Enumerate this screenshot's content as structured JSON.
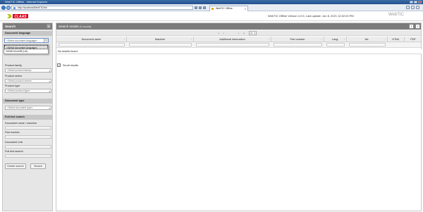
{
  "browser": {
    "title": "WebTIC Offline - Internet Explorer",
    "url": "http://localhost/WebTIC/en/",
    "tab_label": "WebTIC Offline"
  },
  "header": {
    "logo_text": "CLAAS",
    "version_text": "WebTIC Offline Version 4.0.5, Last update: Jun 8, 2021 12:02:03 PM",
    "app_title": "WebTIC"
  },
  "sidebar": {
    "title": "Search",
    "collapse_icon": "«",
    "document_language": {
      "heading": "Document language",
      "selected": "<Select document language>",
      "options": [
        "<Select document language>",
        "УКРАЇНСЬКИЙ (UK)"
      ]
    },
    "product_family_label": "Product family",
    "product_family_value": "<Select product family>",
    "product_series_label": "Product series",
    "product_series_value": "<Select product series>",
    "product_type_label": "Product type",
    "product_type_value": "<Select product type>",
    "document_type": {
      "heading": "Document type",
      "value": "<Select document type>"
    },
    "full_text": {
      "heading": "Full text search",
      "doc_name_label": "Document name / machine",
      "part_number_label": "Part number",
      "doc_link_label": "Document Link",
      "full_text_label": "Full text search"
    },
    "buttons": {
      "delete": "Delete search",
      "search": "Search"
    }
  },
  "results": {
    "title": "Search results",
    "count": "(0 records)",
    "page_size": "15",
    "columns": [
      "Document name",
      "Machine",
      "Additional information",
      "Part number",
      "Lang.",
      "Art.",
      "HTML",
      "PDF"
    ],
    "no_results": "No results found.",
    "scroll_label": "Scroll results",
    "scroll_checked": true
  },
  "colors": {
    "panel_header": "#7b7b7b",
    "brand": "#d9001a",
    "brand_accent": "#b7c600"
  }
}
